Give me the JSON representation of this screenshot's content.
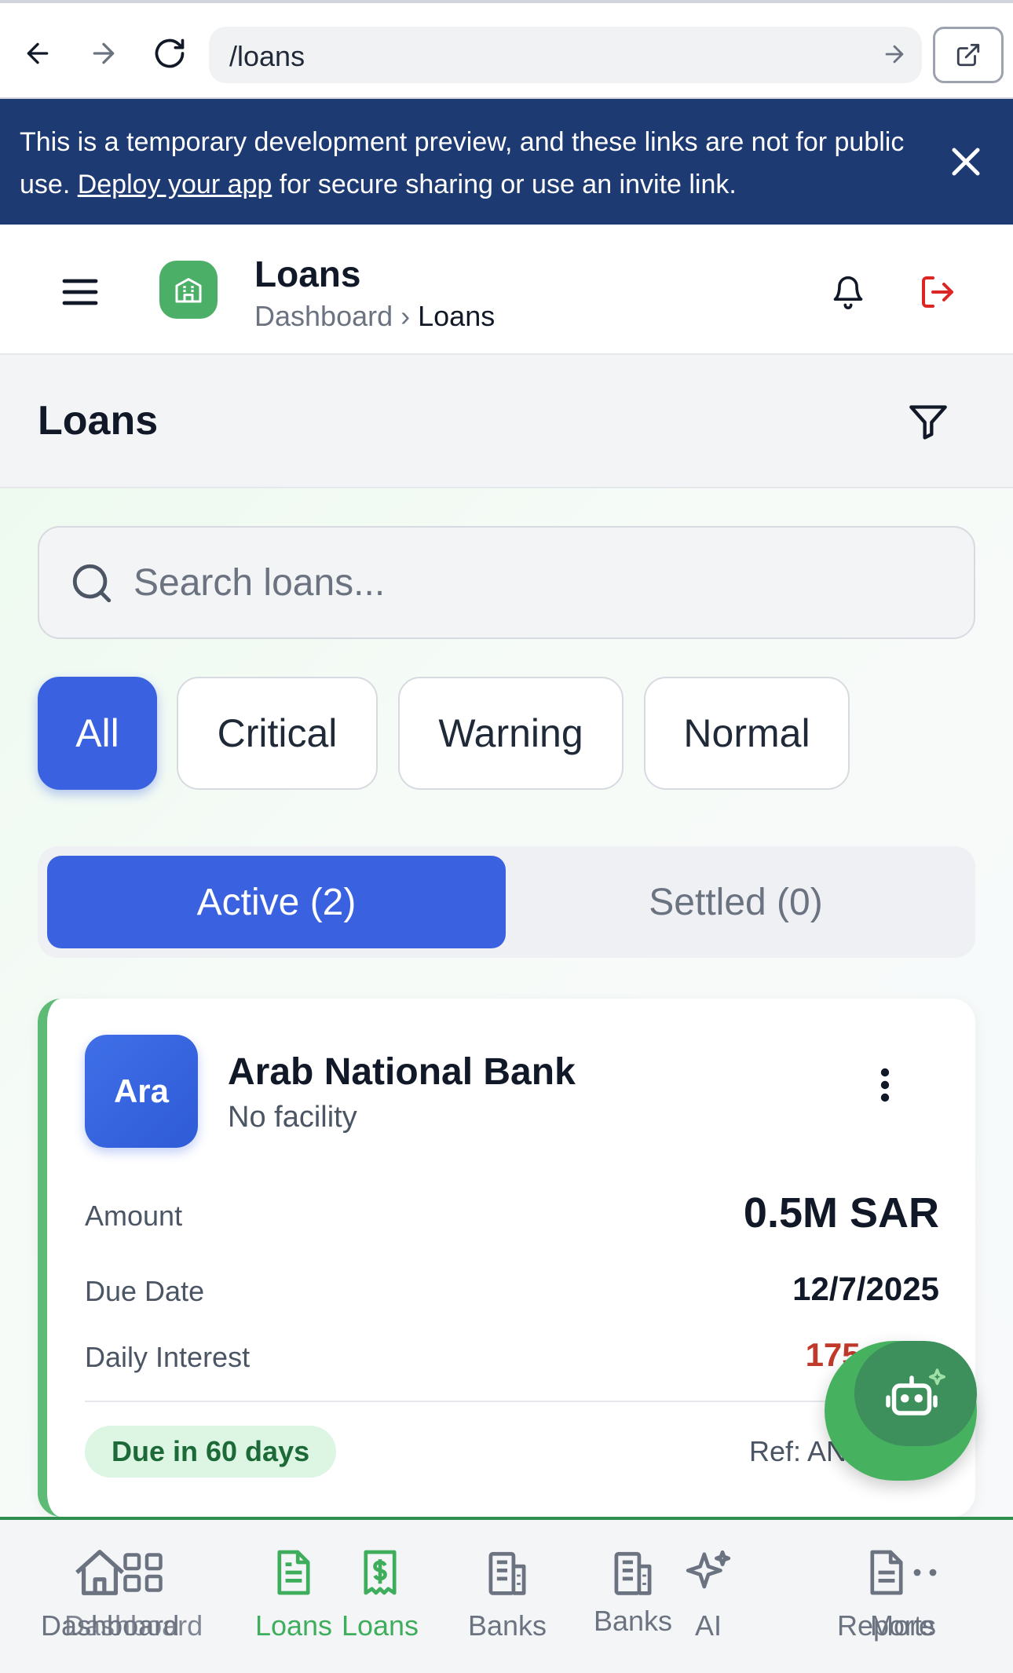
{
  "browser": {
    "url": "/loans"
  },
  "banner": {
    "text_before": "This is a temporary development preview, and these links are not for public use. ",
    "link": "Deploy your app",
    "text_after": " for secure sharing or use an invite link."
  },
  "header": {
    "title": "Loans",
    "breadcrumb": [
      "Dashboard",
      "Loans"
    ],
    "breadcrumb_separator": "›"
  },
  "page": {
    "title": "Loans"
  },
  "search": {
    "placeholder": "Search loans..."
  },
  "filters": {
    "chips": [
      "All",
      "Critical",
      "Warning",
      "Normal"
    ],
    "selected": "All"
  },
  "segments": {
    "active": "Active (2)",
    "settled": "Settled (0)"
  },
  "loan_card": {
    "avatar": "Ara",
    "bank": "Arab National Bank",
    "facility": "No facility",
    "rows": [
      {
        "label": "Amount",
        "value": "0.5M SAR"
      },
      {
        "label": "Due Date",
        "value": "12/7/2025"
      },
      {
        "label": "Daily Interest",
        "value": "175 SAR"
      }
    ],
    "due_badge": "Due in 60 days",
    "ref": "Ref: AN"
  },
  "tabbar": {
    "tabs": [
      {
        "label": "Dashboard",
        "icon": "home-icon"
      },
      {
        "label": "Dashboard",
        "icon": "grid-icon"
      },
      {
        "label": "Loans",
        "icon": "document-icon"
      },
      {
        "label": "Loans",
        "icon": "receipt-dollar-icon"
      },
      {
        "label": "Banks",
        "icon": "bank-icon"
      },
      {
        "label": "Banks",
        "icon": "bank-icon"
      },
      {
        "label": "AI",
        "icon": "sparkle-icon"
      },
      {
        "label": "Reports",
        "icon": "report-icon"
      },
      {
        "label": "More",
        "icon": "more-icon"
      }
    ]
  },
  "colors": {
    "primary": "#3a62e0",
    "banner": "#1e3a72",
    "success": "#46b260",
    "danger": "#c0392b"
  }
}
